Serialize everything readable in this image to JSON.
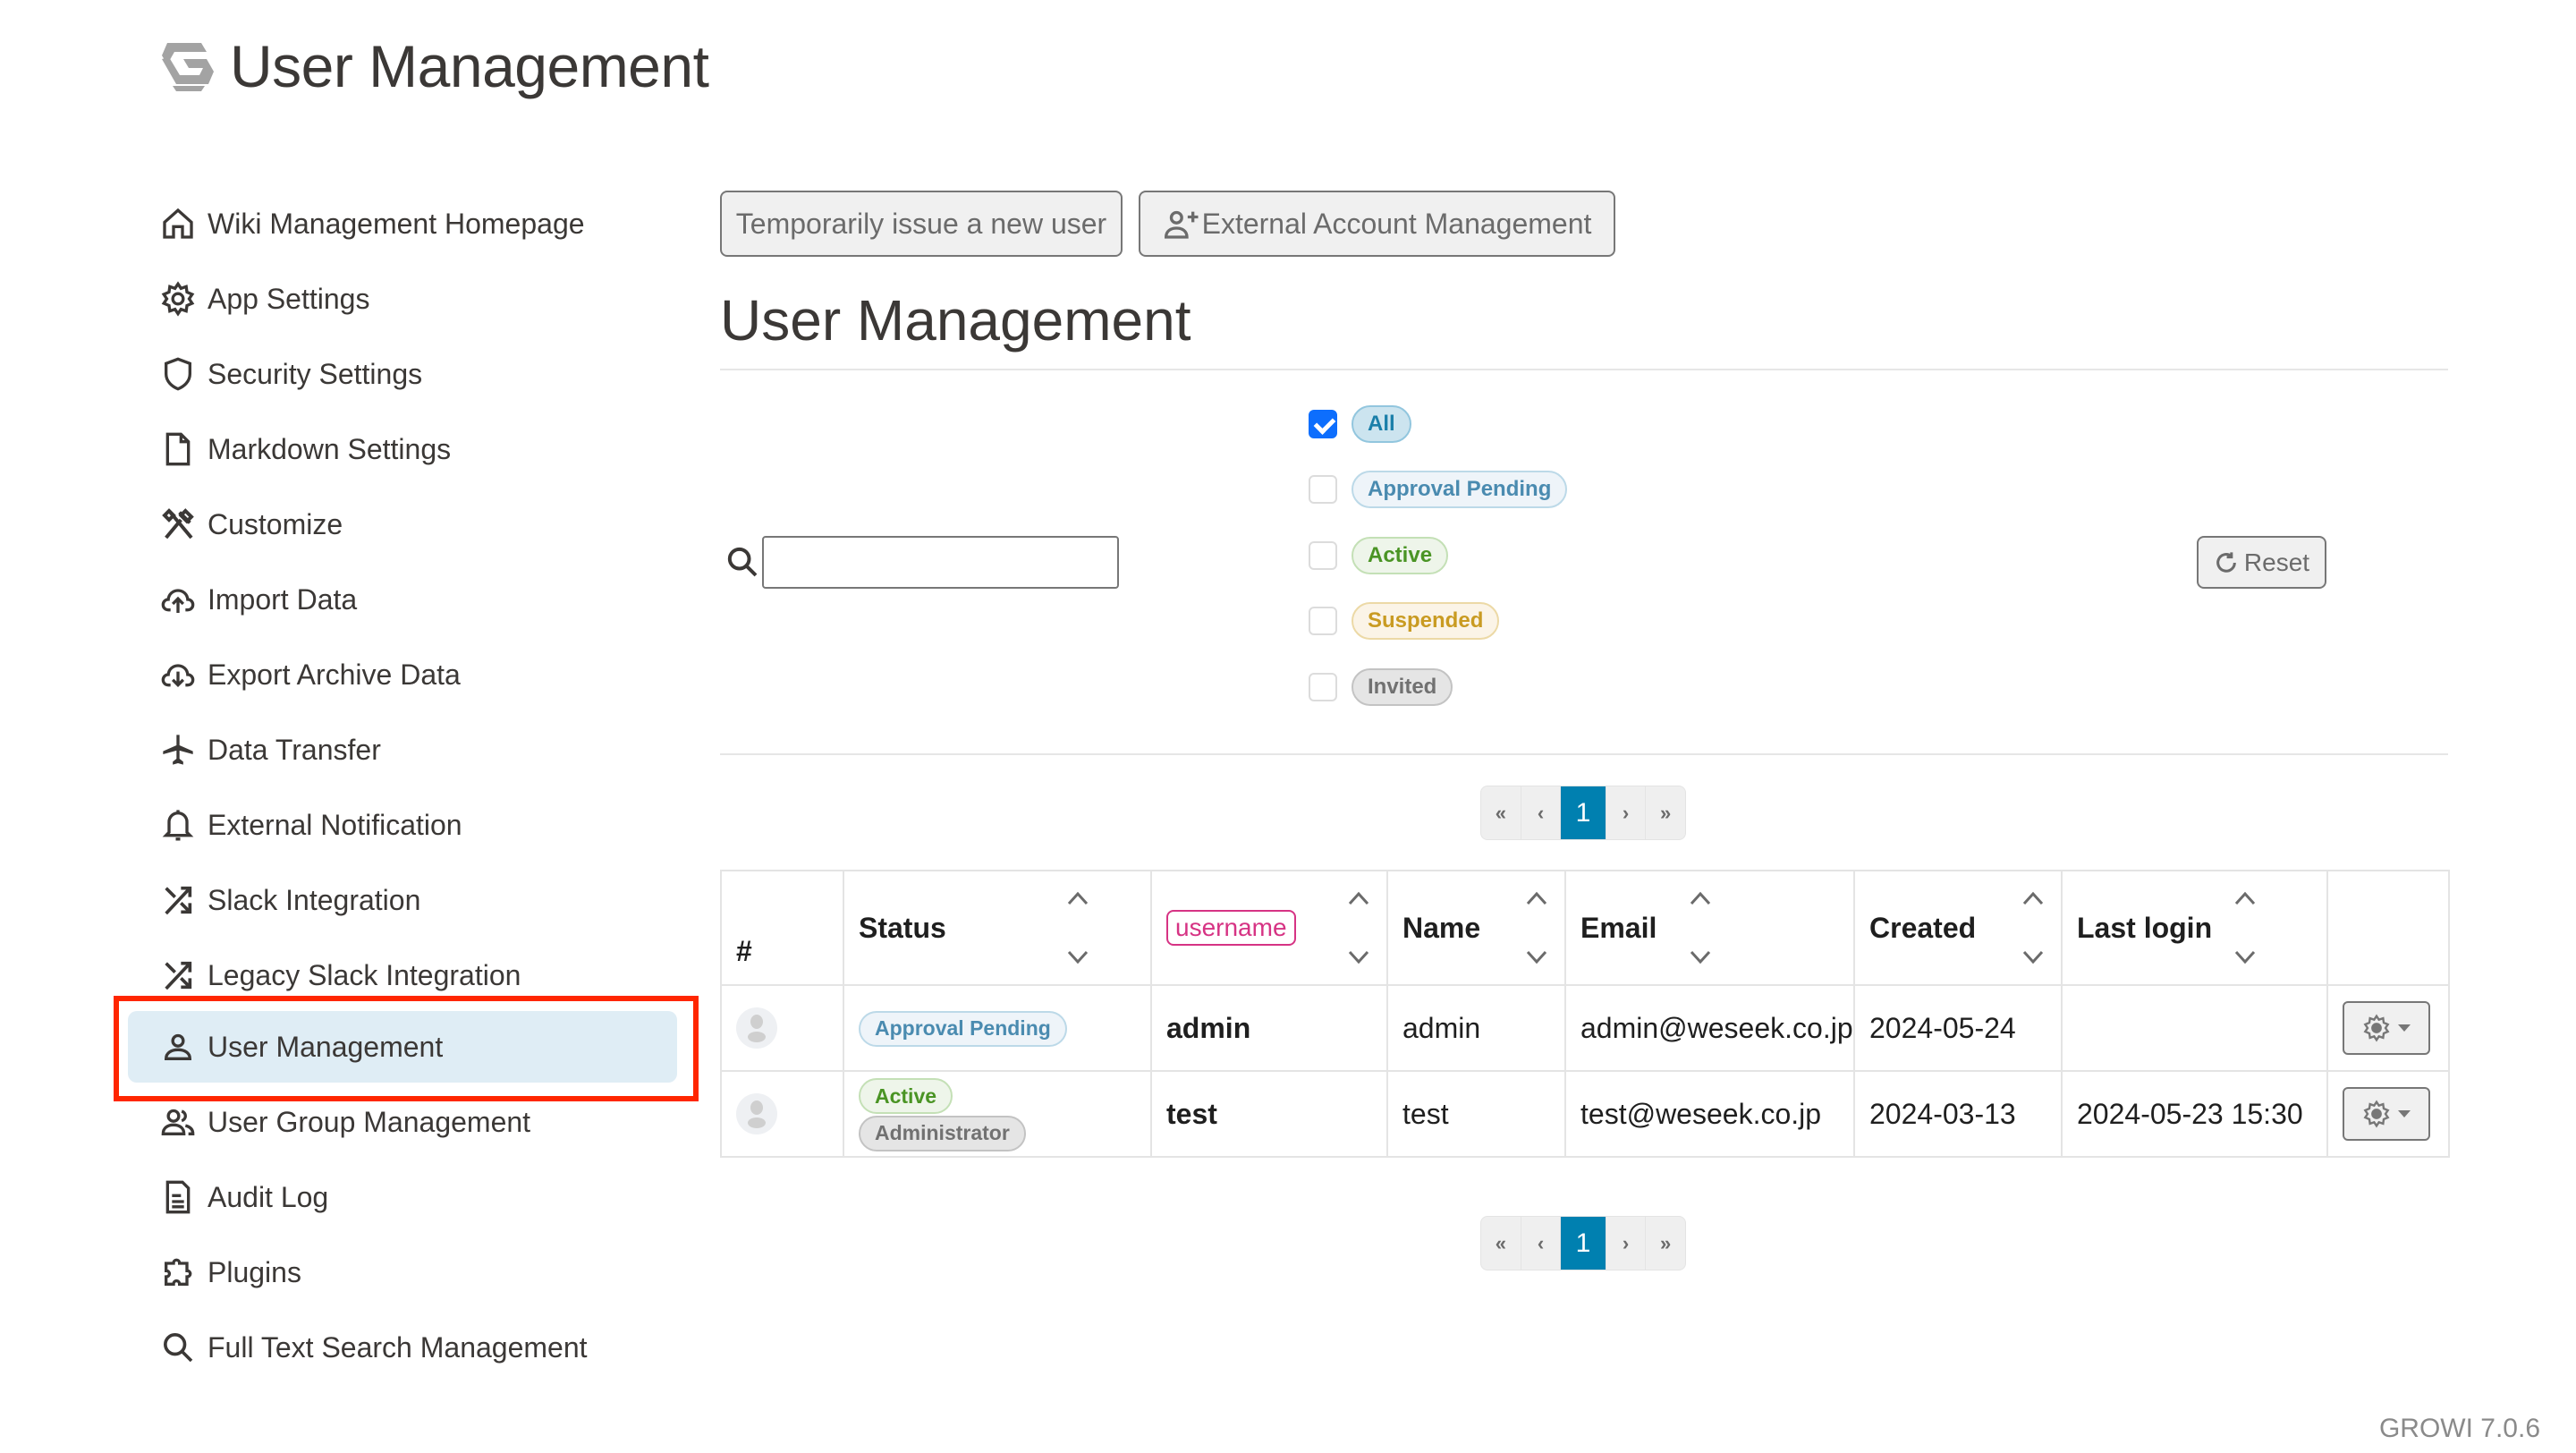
{
  "header": {
    "title": "User Management",
    "logo_icon": "growi-logo-icon"
  },
  "sidebar": {
    "items": [
      {
        "label": "Wiki Management Homepage",
        "icon": "home-icon"
      },
      {
        "label": "App Settings",
        "icon": "gear-icon"
      },
      {
        "label": "Security Settings",
        "icon": "shield-icon"
      },
      {
        "label": "Markdown Settings",
        "icon": "file-icon"
      },
      {
        "label": "Customize",
        "icon": "tools-icon"
      },
      {
        "label": "Import Data",
        "icon": "cloud-upload-icon"
      },
      {
        "label": "Export Archive Data",
        "icon": "cloud-download-icon"
      },
      {
        "label": "Data Transfer",
        "icon": "airplane-icon"
      },
      {
        "label": "External Notification",
        "icon": "bell-icon"
      },
      {
        "label": "Slack Integration",
        "icon": "shuffle-icon"
      },
      {
        "label": "Legacy Slack Integration",
        "icon": "shuffle-icon"
      },
      {
        "label": "User Management",
        "icon": "person-icon",
        "active": true
      },
      {
        "label": "User Group Management",
        "icon": "people-icon"
      },
      {
        "label": "Audit Log",
        "icon": "document-icon"
      },
      {
        "label": "Plugins",
        "icon": "puzzle-icon"
      },
      {
        "label": "Full Text Search Management",
        "icon": "search-icon"
      }
    ]
  },
  "toolbar": {
    "issue_user_label": "Temporarily issue a new user",
    "external_account_label": "External Account Management"
  },
  "main": {
    "title": "User Management",
    "search": {
      "value": "",
      "placeholder": ""
    },
    "filters": [
      {
        "label": "All",
        "checked": true
      },
      {
        "label": "Approval Pending",
        "checked": false
      },
      {
        "label": "Active",
        "checked": false
      },
      {
        "label": "Suspended",
        "checked": false
      },
      {
        "label": "Invited",
        "checked": false
      }
    ],
    "reset_label": "Reset",
    "pagination": {
      "first": "«",
      "prev": "‹",
      "current": "1",
      "next": "›",
      "last": "»"
    }
  },
  "table": {
    "columns": [
      "#",
      "Status",
      "username",
      "Name",
      "Email",
      "Created",
      "Last login",
      ""
    ],
    "rows": [
      {
        "statuses": [
          "Approval Pending"
        ],
        "username": "admin",
        "name": "admin",
        "email": "admin@weseek.co.jp",
        "created": "2024-05-24",
        "last_login": ""
      },
      {
        "statuses": [
          "Active",
          "Administrator"
        ],
        "username": "test",
        "name": "test",
        "email": "test@weseek.co.jp",
        "created": "2024-03-13",
        "last_login": "2024-05-23 15:30"
      }
    ]
  },
  "colors": {
    "accent": "#0080b0",
    "active_nav_bg": "#dfedf5",
    "highlight_border": "#ff2600",
    "username_code": "#d63384",
    "checkbox_checked": "#0d6efd"
  },
  "footer": {
    "version": "GROWI 7.0.6"
  }
}
